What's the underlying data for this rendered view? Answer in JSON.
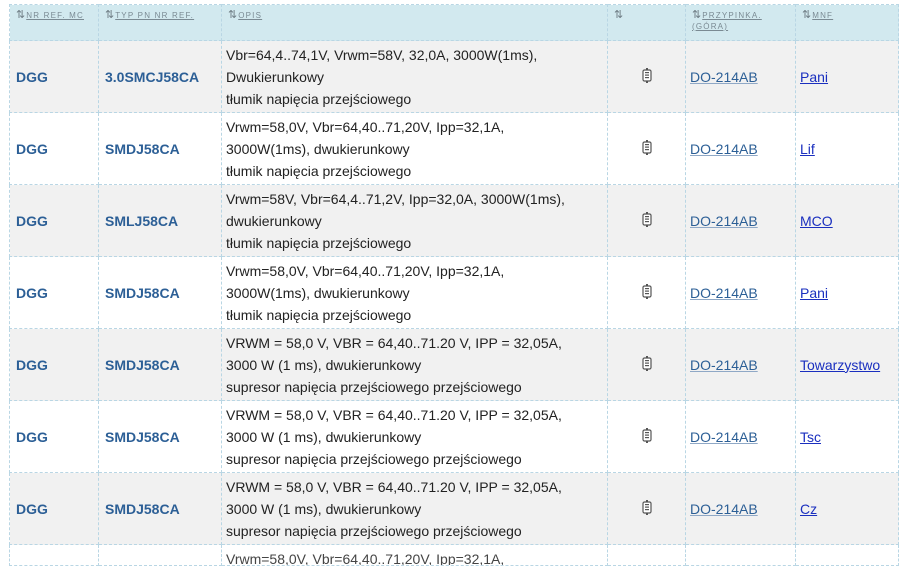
{
  "headers": {
    "mfr_ref": "NR REF. MC",
    "part_type": "TYP PN NR REF.",
    "description": "OPIS",
    "icon_col": "",
    "package": "PRZYPINKA. (GÓRA)",
    "mnf": "MNF"
  },
  "sort_glyph": "⇅",
  "rows": [
    {
      "mfr": "DGG",
      "pn": "3.0SMCJ58CA",
      "desc": [
        "Vbr=64,4..74,1V, Vrwm=58V, 32,0A, 3000W(1ms),",
        "Dwukierunkowy",
        "tłumik napięcia przejściowego"
      ],
      "pkg": "DO-214AB",
      "mnf": "Pani"
    },
    {
      "mfr": "DGG",
      "pn": "SMDJ58CA",
      "desc": [
        "Vrwm=58,0V, Vbr=64,40..71,20V, Ipp=32,1A,",
        "3000W(1ms), dwukierunkowy",
        "tłumik napięcia przejściowego"
      ],
      "pkg": "DO-214AB",
      "mnf": "Lif"
    },
    {
      "mfr": "DGG",
      "pn": "SMLJ58CA",
      "desc": [
        "Vrwm=58V, Vbr=64,4..71,2V, Ipp=32,0A, 3000W(1ms),",
        "dwukierunkowy",
        "tłumik napięcia przejściowego"
      ],
      "pkg": "DO-214AB",
      "mnf": "MCO"
    },
    {
      "mfr": "DGG",
      "pn": "SMDJ58CA",
      "desc": [
        "Vrwm=58,0V, Vbr=64,40..71,20V, Ipp=32,1A,",
        "3000W(1ms), dwukierunkowy",
        "tłumik napięcia przejściowego"
      ],
      "pkg": "DO-214AB",
      "mnf": "Pani"
    },
    {
      "mfr": "DGG",
      "pn": "SMDJ58CA",
      "desc": [
        "VRWM = 58,0 V, VBR = 64,40..71.20 V, IPP = 32,05A,",
        "3000 W (1 ms), dwukierunkowy",
        "supresor napięcia przejściowego przejściowego"
      ],
      "pkg": "DO-214AB",
      "mnf": "Towarzystwo"
    },
    {
      "mfr": "DGG",
      "pn": "SMDJ58CA",
      "desc": [
        "VRWM = 58,0 V, VBR = 64,40..71.20 V, IPP = 32,05A,",
        "3000 W (1 ms), dwukierunkowy",
        "supresor napięcia przejściowego przejściowego"
      ],
      "pkg": "DO-214AB",
      "mnf": "Tsc"
    },
    {
      "mfr": "DGG",
      "pn": "SMDJ58CA",
      "desc": [
        "VRWM = 58,0 V, VBR = 64,40..71.20 V, IPP = 32,05A,",
        "3000 W (1 ms), dwukierunkowy",
        "supresor napięcia przejściowego przejściowego"
      ],
      "pkg": "DO-214AB",
      "mnf": "Cz"
    }
  ],
  "partial_row_text": "Vrwm=58,0V, Vbr=64,40..71,20V, Ipp=32,1A,",
  "icon": "component-icon"
}
